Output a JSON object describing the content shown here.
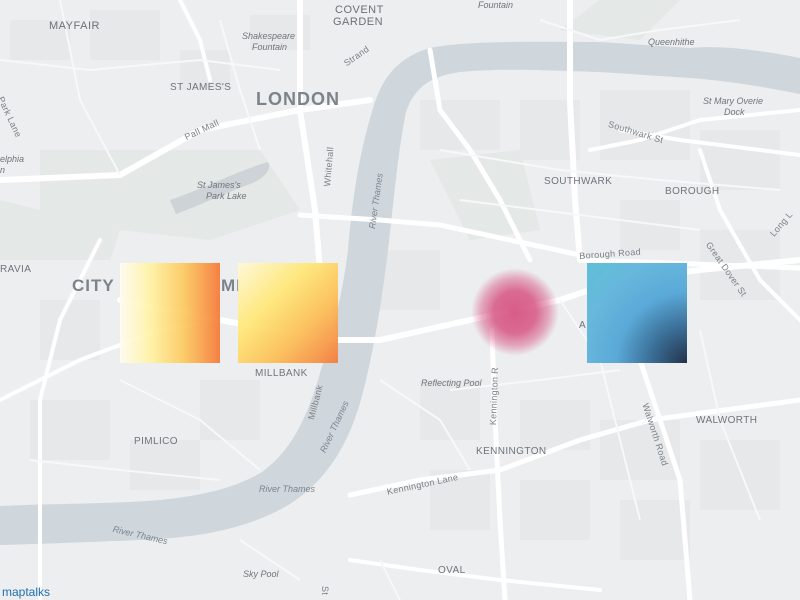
{
  "map": {
    "attribution": "maptalks",
    "labels": {
      "mayfair": "MAYFAIR",
      "covent_garden_1": "COVENT",
      "covent_garden_2": "GARDEN",
      "fountain": "Fountain",
      "shakespeare_1": "Shakespeare",
      "shakespeare_2": "Fountain",
      "queenhithe": "Queenhithe",
      "st_james": "ST JAMES'S",
      "london": "LONDON",
      "st_mary_1": "St Mary Overie",
      "st_mary_2": "Dock",
      "southwark_st": "Southwark St",
      "strand": "Strand",
      "pall_mall": "Pall Mall",
      "whitehall": "Whitehall",
      "river_thames_1": "River Thames",
      "park_lane": "Park Lane",
      "delphia_1": "elphia",
      "delphia_2": "n",
      "southwark": "SOUTHWARK",
      "borough": "BOROUGH",
      "st_james_park_1": "St James's",
      "st_james_park_2": "Park Lake",
      "borough_road": "Borough Road",
      "great_dover": "Great Dover St",
      "long_lane": "Long L",
      "belgravia": "RAVIA",
      "city_prefix": "CITY",
      "city_suffix": "MI",
      "marker_a": "A",
      "millbank": "MILLBANK",
      "reflecting_pool": "Reflecting Pool",
      "kennington_road": "Kennington R",
      "walworth_road": "Walworth Road",
      "walworth": "WALWORTH",
      "millbank_road": "Millbank",
      "river_thames_2": "River Thames",
      "pimlico": "PIMLICO",
      "kennington": "KENNINGTON",
      "river_thames_3": "River Thames",
      "kennington_lane": "Kennington Lane",
      "river_thames_4": "River Thames",
      "sky_pool": "Sky Pool",
      "oval": "OVAL",
      "st_road": "St"
    }
  },
  "overlays": {
    "square_1_color_from": "#fffcf0",
    "square_1_color_to": "#f57b3c",
    "square_2_color_from": "#fff9d8",
    "square_2_color_to": "#f47c40",
    "blob_color": "#d65482",
    "square_3_color_from": "#5ec0d6",
    "square_3_color_to": "#23324a"
  }
}
